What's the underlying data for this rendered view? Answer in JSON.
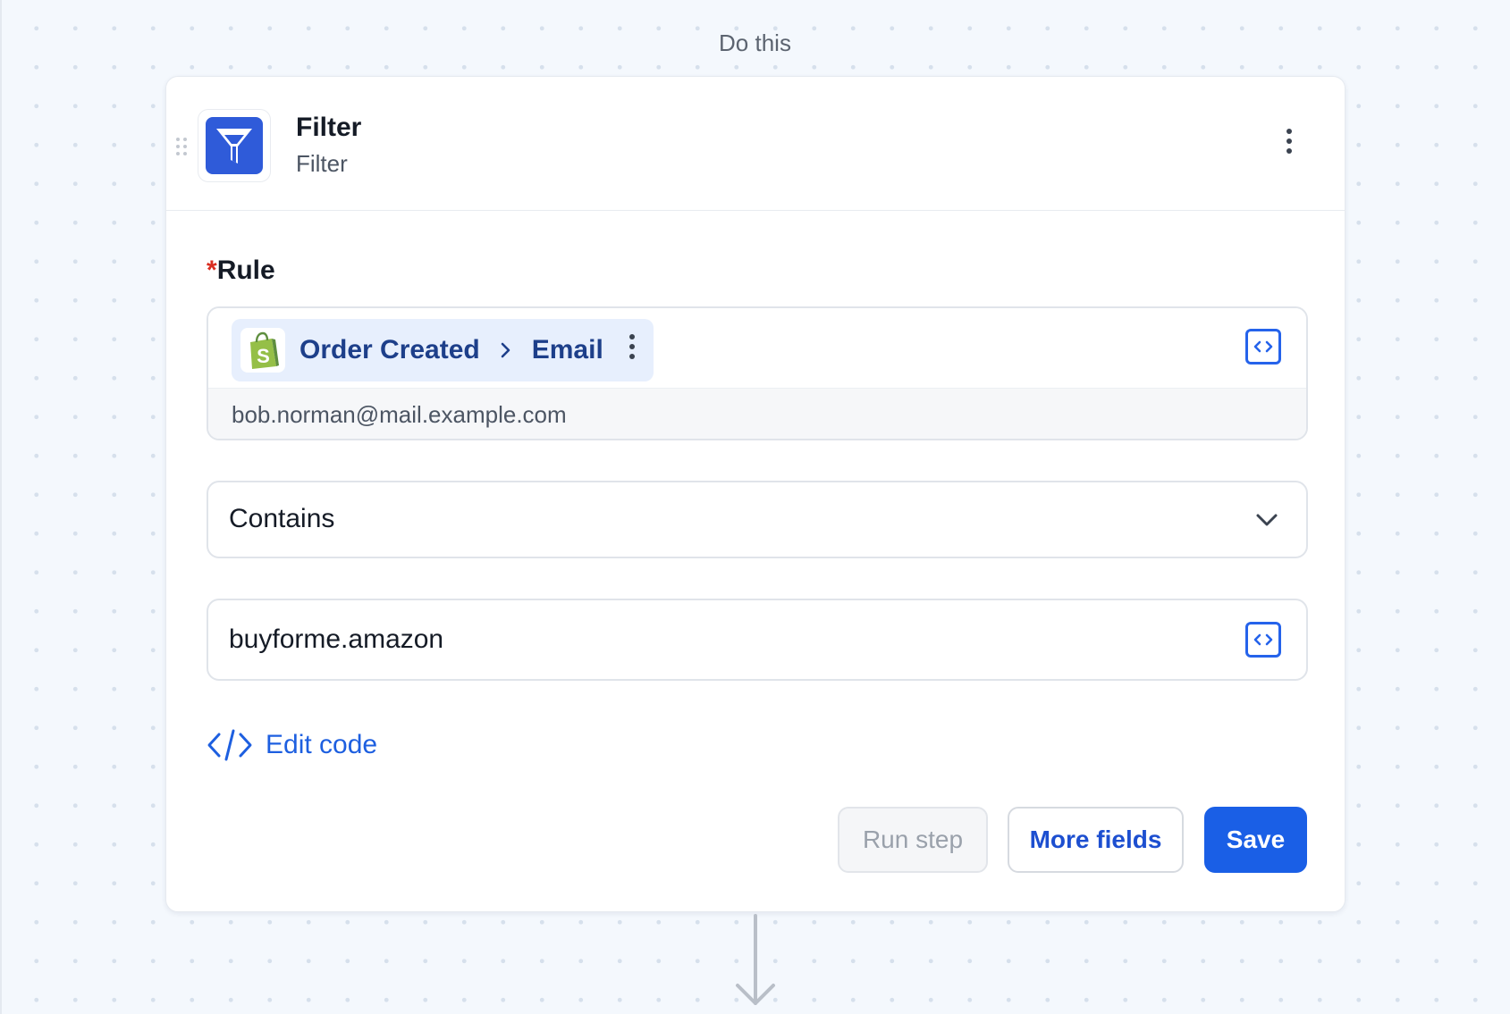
{
  "canvas": {
    "section_label": "Do this"
  },
  "step": {
    "title": "Filter",
    "subtitle": "Filter",
    "icon": "funnel-icon",
    "icon_color": "#2f5bd9"
  },
  "rule": {
    "required_mark": "*",
    "label": "Rule",
    "source": {
      "app_icon": "shopify-bag-icon",
      "trigger": "Order Created",
      "field": "Email",
      "preview_value": "bob.norman@mail.example.com"
    },
    "operator": "Contains",
    "value": "buyforme.amazon"
  },
  "actions": {
    "edit_code_label": "Edit code",
    "run_step_label": "Run step",
    "more_fields_label": "More fields",
    "save_label": "Save"
  },
  "colors": {
    "primary": "#1a5fe6",
    "link": "#1d5fe0",
    "pill_bg": "#e7effd",
    "pill_text": "#1d3f8a",
    "required": "#d92d20",
    "canvas_bg": "#f4f8fd"
  }
}
